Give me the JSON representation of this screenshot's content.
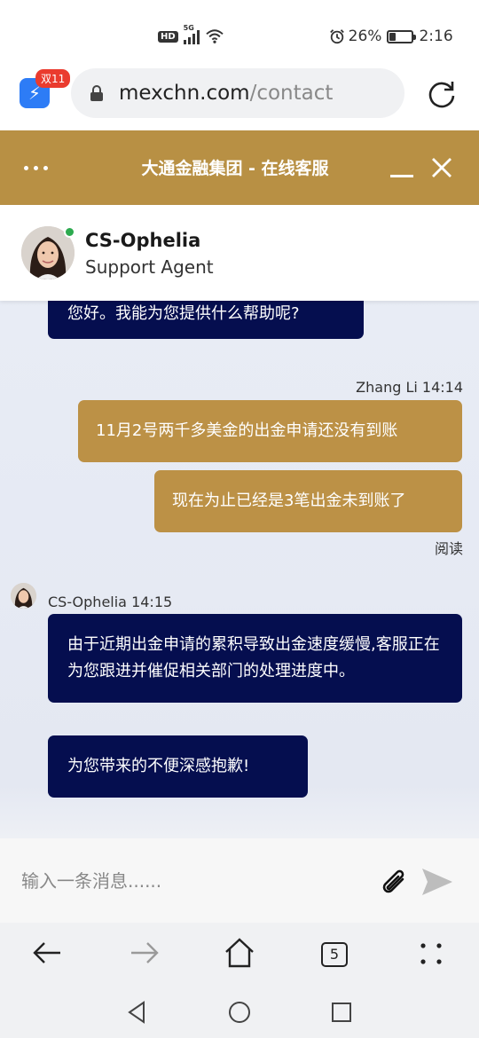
{
  "status_bar": {
    "network": "5G",
    "hd": "HD",
    "battery_text": "26%",
    "battery_level": 0.26,
    "time": "2:16"
  },
  "browser": {
    "badge": "双11",
    "url_domain": "mexchn.com",
    "url_path": "/contact",
    "tab_count": "5"
  },
  "chat": {
    "title": "大通金融集团 - 在线客服",
    "agent": {
      "name": "CS-Ophelia",
      "role": "Support Agent",
      "status_color": "#2daa4f"
    },
    "messages": [
      {
        "from": "agent",
        "text": "您好。我能为您提供什么帮助呢?"
      },
      {
        "from": "user",
        "meta": "Zhang Li 14:14",
        "text": "11月2号两千多美金的出金申请还没有到账"
      },
      {
        "from": "user",
        "text": "现在为止已经是3笔出金未到账了",
        "status": "阅读"
      },
      {
        "from": "agent",
        "meta": "CS-Ophelia 14:15",
        "text": "由于近期出金申请的累积导致出金速度缓慢,客服正在为您跟进并催促相关部门的处理进度中。"
      },
      {
        "from": "agent",
        "text": "为您带来的不便深感抱歉!"
      }
    ],
    "input_placeholder": "输入一条消息......"
  },
  "colors": {
    "header": "#b89044",
    "agent_bubble": "#050e4f",
    "user_bubble": "#bc9146"
  }
}
